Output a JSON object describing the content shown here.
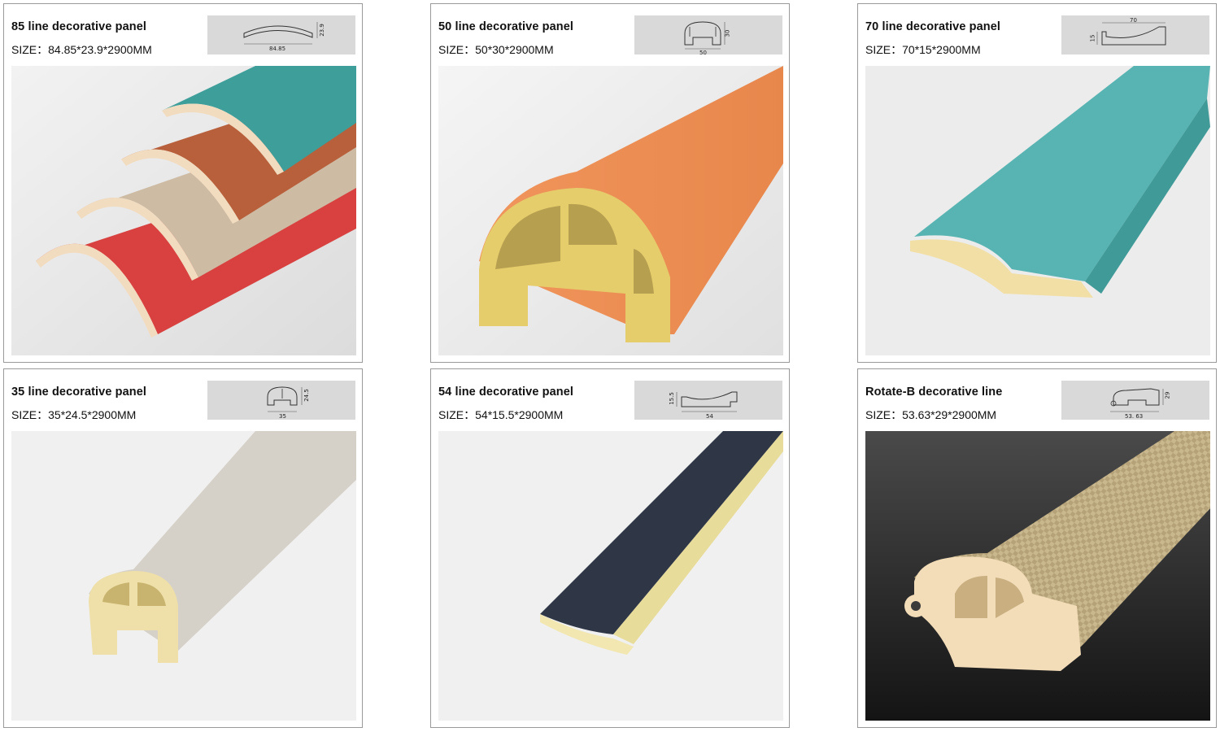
{
  "cards": [
    {
      "title": "85 line decorative panel",
      "size": "SIZE：84.85*23.9*2900MM",
      "dims": {
        "w": "84.85",
        "h": "23.9"
      },
      "colors": [
        "#3d9e9a",
        "#b8603c",
        "#cdbba4",
        "#d8413f"
      ]
    },
    {
      "title": "50 line decorative panel",
      "size": "SIZE：50*30*2900MM",
      "dims": {
        "w": "50",
        "h": "30"
      },
      "colors": [
        "#ec8f55"
      ]
    },
    {
      "title": "70 line decorative panel",
      "size": "SIZE：70*15*2900MM",
      "dims": {
        "w": "70",
        "h": "15"
      },
      "colors": [
        "#57b4b2"
      ]
    },
    {
      "title": "35 line decorative panel",
      "size": "SIZE：35*24.5*2900MM",
      "dims": {
        "w": "35",
        "h": "24.5"
      },
      "colors": [
        "#d6d1c8"
      ]
    },
    {
      "title": "54 line decorative panel",
      "size": "SIZE：54*15.5*2900MM",
      "dims": {
        "w": "54",
        "h": "15.5"
      },
      "colors": [
        "#2f3646"
      ]
    },
    {
      "title": "Rotate-B decorative line",
      "size": "SIZE：53.63*29*2900MM",
      "dims": {
        "w": "53. 63",
        "h": "29"
      },
      "colors": [
        "#c9b78e"
      ]
    }
  ]
}
